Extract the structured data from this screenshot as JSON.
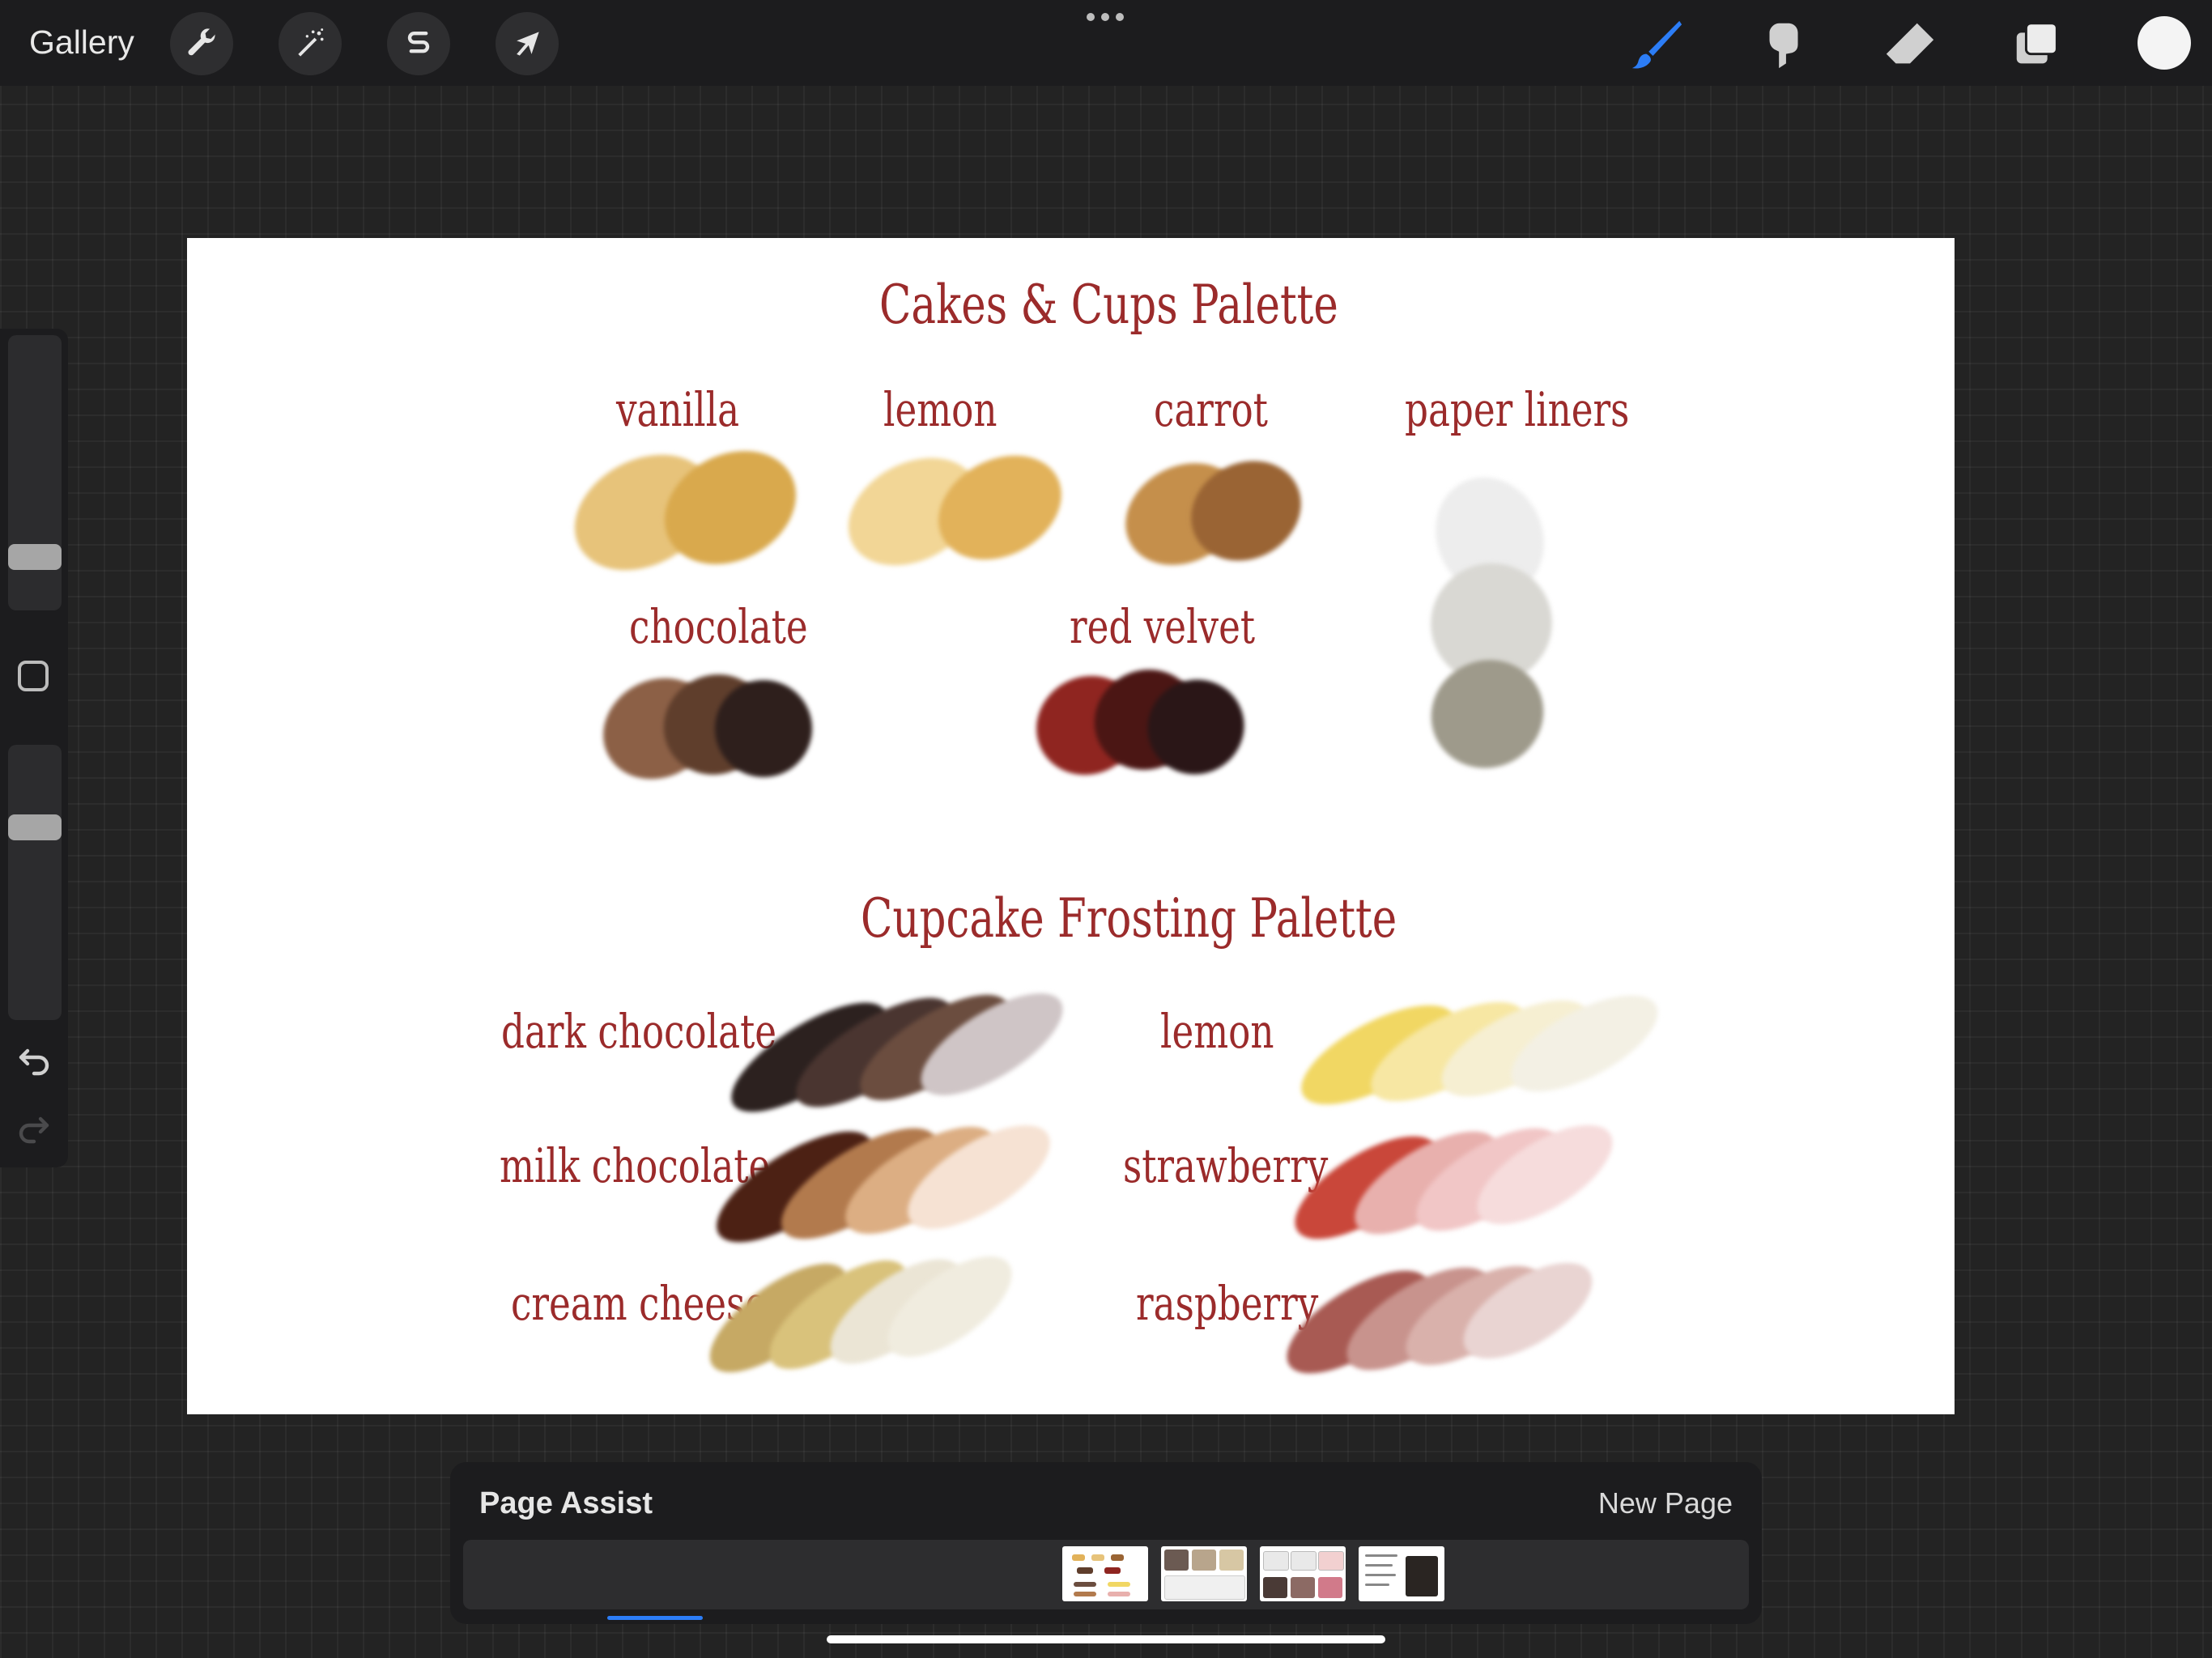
{
  "toolbar": {
    "gallery_label": "Gallery",
    "left_tools": [
      "wrench-icon",
      "magic-wand-icon",
      "selection-s-icon",
      "transform-arrow-icon"
    ],
    "right_tools": [
      "brush-icon",
      "smudge-icon",
      "eraser-icon",
      "layers-icon"
    ],
    "active_tool": "brush-icon",
    "current_color": "#f4f4f4",
    "accent_color": "#2c7df6"
  },
  "sidebar": {
    "brush_size": 0.25,
    "brush_opacity": 0.3
  },
  "artwork": {
    "cakes_title": "Cakes & Cups Palette",
    "cake_labels": [
      "vanilla",
      "lemon",
      "carrot",
      "paper liners",
      "chocolate",
      "red velvet"
    ],
    "frosting_title": "Cupcake Frosting Palette",
    "frosting_labels": [
      "dark chocolate",
      "lemon",
      "milk chocolate",
      "strawberry",
      "cream cheese",
      "raspberry"
    ],
    "label_color": "#9b2b2b"
  },
  "page_assist": {
    "title": "Page Assist",
    "new_page_label": "New Page",
    "pages_count": 4,
    "selected_page_index": 0
  }
}
